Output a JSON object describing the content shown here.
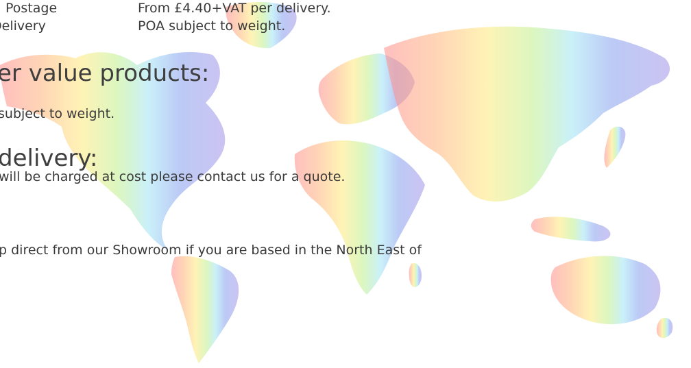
{
  "shipping_table": {
    "rows": [
      {
        "method": "Postage",
        "detail": "From £4.40+VAT per delivery."
      },
      {
        "method": "Delivery",
        "detail": "POA subject to weight."
      }
    ]
  },
  "sections": [
    {
      "heading": "er value products:",
      "body": "subject to weight."
    },
    {
      "heading": "delivery:",
      "body": "will be charged at cost please contact us for a quote."
    }
  ],
  "collection": {
    "prefix": "p direct from our ",
    "link_text": "Showroom",
    "suffix": " if you are based in the North East of"
  },
  "background": {
    "image": "rainbow-world-map",
    "colors": [
      "#ff9a9a",
      "#ffc58a",
      "#fff09a",
      "#c8ef9a",
      "#aee8f6",
      "#9fb4f2",
      "#b2a8ee"
    ]
  }
}
